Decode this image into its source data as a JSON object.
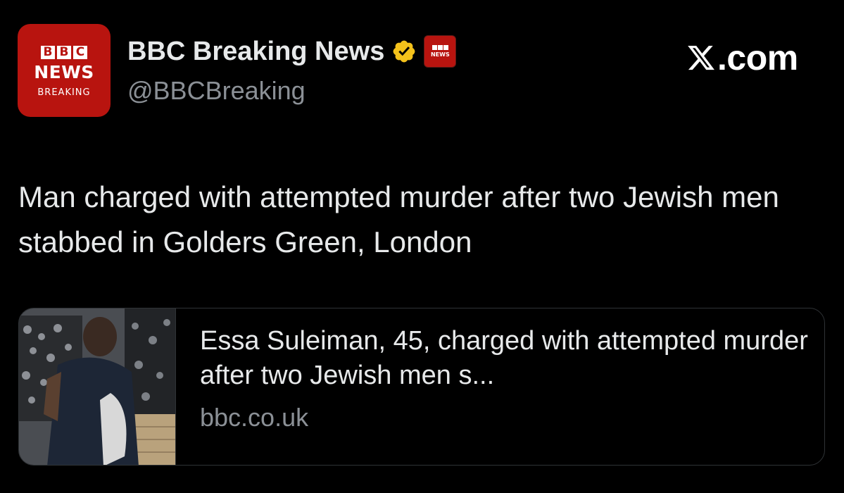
{
  "author": {
    "display_name": "BBC Breaking News",
    "handle": "@BBCBreaking",
    "avatar": {
      "bbc_letters": [
        "B",
        "B",
        "C"
      ],
      "line1": "NEWS",
      "line2": "BREAKING",
      "bg_color": "#b8140f"
    },
    "verified_icon": "gold-verified-badge-icon",
    "verified_color": "#f4c21b",
    "org_badge": {
      "line1": "NEWS"
    }
  },
  "brand": {
    "site": ".com"
  },
  "tweet": {
    "text": "Man charged with attempted murder after two Jewish men stabbed in Golders Green, London"
  },
  "link_card": {
    "title": "Essa Suleiman, 45, charged with attempted murder after two Jewish men s...",
    "domain": "bbc.co.uk"
  },
  "colors": {
    "background": "#000000",
    "text_primary": "#e7e9ea",
    "text_secondary": "#8b9096",
    "border": "#2f3336"
  }
}
